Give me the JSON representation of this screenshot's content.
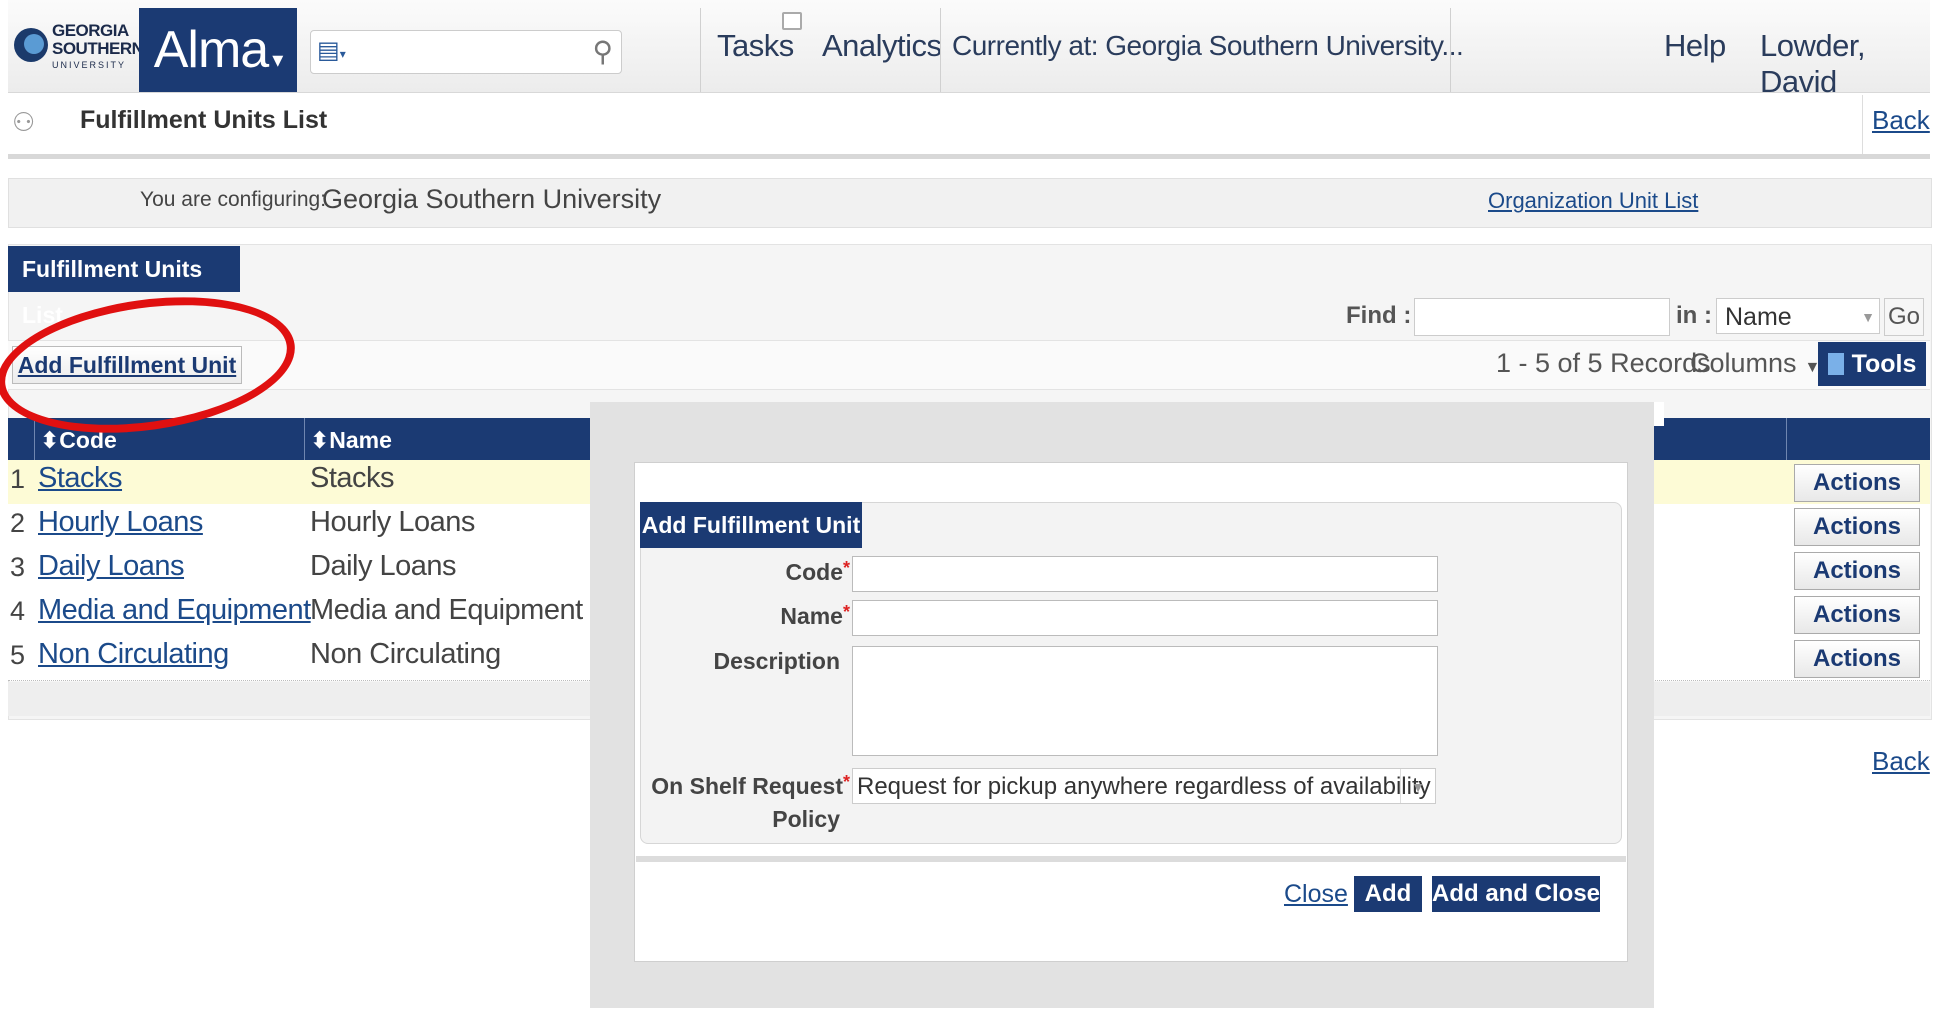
{
  "header": {
    "logo": {
      "line1": "GEORGIA",
      "line2": "SOUTHERN",
      "line3": "UNIVERSITY"
    },
    "app_name": "Alma",
    "search_placeholder": "",
    "nav": {
      "tasks": "Tasks",
      "analytics": "Analytics",
      "location": "Currently at: Georgia Southern University...",
      "help": "Help",
      "user": "Lowder, David"
    }
  },
  "page": {
    "title": "Fulfillment Units List",
    "back": "Back",
    "back_bottom": "Back"
  },
  "config": {
    "label": "You are configuring:",
    "value": "Georgia Southern University",
    "org_link": "Organization Unit List"
  },
  "list": {
    "tab": "Fulfillment Units List",
    "find_label": "Find :",
    "find_value": "",
    "in_label": "in :",
    "in_value": "Name",
    "go": "Go",
    "add_button": "Add Fulfillment Unit",
    "records": "1 - 5 of 5 Records",
    "columns": "Columns",
    "tools": "Tools",
    "headers": {
      "code": "Code",
      "name": "Name"
    },
    "rows": [
      {
        "num": "1",
        "code": "Stacks",
        "name": "Stacks",
        "action": "Actions"
      },
      {
        "num": "2",
        "code": "Hourly Loans",
        "name": "Hourly Loans",
        "action": "Actions"
      },
      {
        "num": "3",
        "code": "Daily Loans",
        "name": "Daily Loans",
        "action": "Actions"
      },
      {
        "num": "4",
        "code": "Media and Equipment",
        "name": "Media and Equipment",
        "action": "Actions"
      },
      {
        "num": "5",
        "code": "Non Circulating",
        "name": "Non Circulating",
        "action": "Actions"
      }
    ]
  },
  "modal": {
    "tab": "Add Fulfillment Unit",
    "fields": {
      "code": {
        "label": "Code",
        "value": ""
      },
      "name": {
        "label": "Name",
        "value": ""
      },
      "description": {
        "label": "Description",
        "value": ""
      },
      "policy": {
        "label1": "On Shelf Request",
        "label2": "Policy",
        "value": "Request for pickup anywhere regardless of availability"
      }
    },
    "buttons": {
      "close": "Close",
      "add": "Add",
      "add_close": "Add and Close"
    }
  },
  "colors": {
    "brand_navy": "#1b3a73",
    "link": "#1b4a8a",
    "highlight_row": "#fdfbd6",
    "annotation_red": "#e01010"
  },
  "icons": [
    "search-icon",
    "catalog-dropdown-icon",
    "tasks-flag-icon",
    "users-icon",
    "sort-icon",
    "tools-icon",
    "dropdown-arrow-icon"
  ]
}
